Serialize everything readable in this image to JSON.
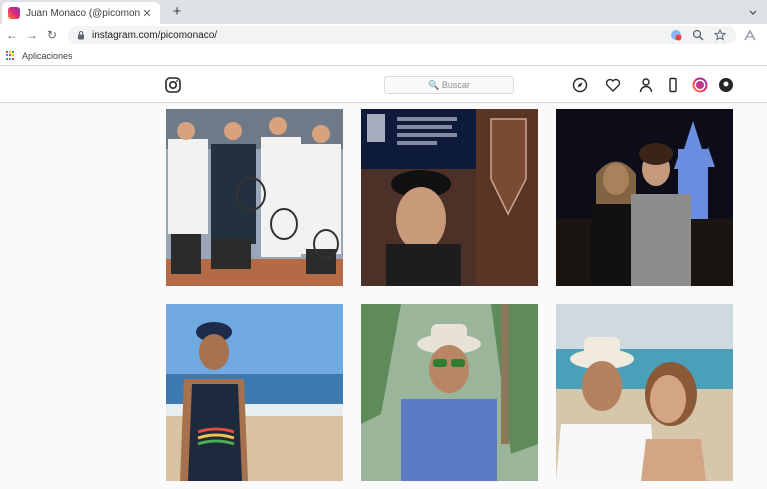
{
  "browser": {
    "tab_title": "Juan Monaco (@picomonaco) • I",
    "tab_close": "✕",
    "new_tab": "+",
    "back": "←",
    "forward": "→",
    "reload": "↻",
    "url": "instagram.com/picomonaco/",
    "bookmarks": [
      {
        "label": "Aplicaciones"
      }
    ]
  },
  "instagram": {
    "search_placeholder": "🔍 Buscar",
    "nav_icons": [
      "compass-icon",
      "heart-icon",
      "profile-icon",
      "phone-icon",
      "story-ring-icon",
      "extension-icon"
    ]
  },
  "posts": [
    {
      "subject": "tennis players group photo"
    },
    {
      "subject": "man at festival event"
    },
    {
      "subject": "couple in front of castle"
    },
    {
      "subject": "man on beach"
    },
    {
      "subject": "man with hat and sunglasses"
    },
    {
      "subject": "couple with hat selfie"
    }
  ],
  "colors": {
    "chrome_strip": "#dee1e6",
    "ig_border": "#dbdbdb",
    "ig_bg": "#fafafa"
  }
}
